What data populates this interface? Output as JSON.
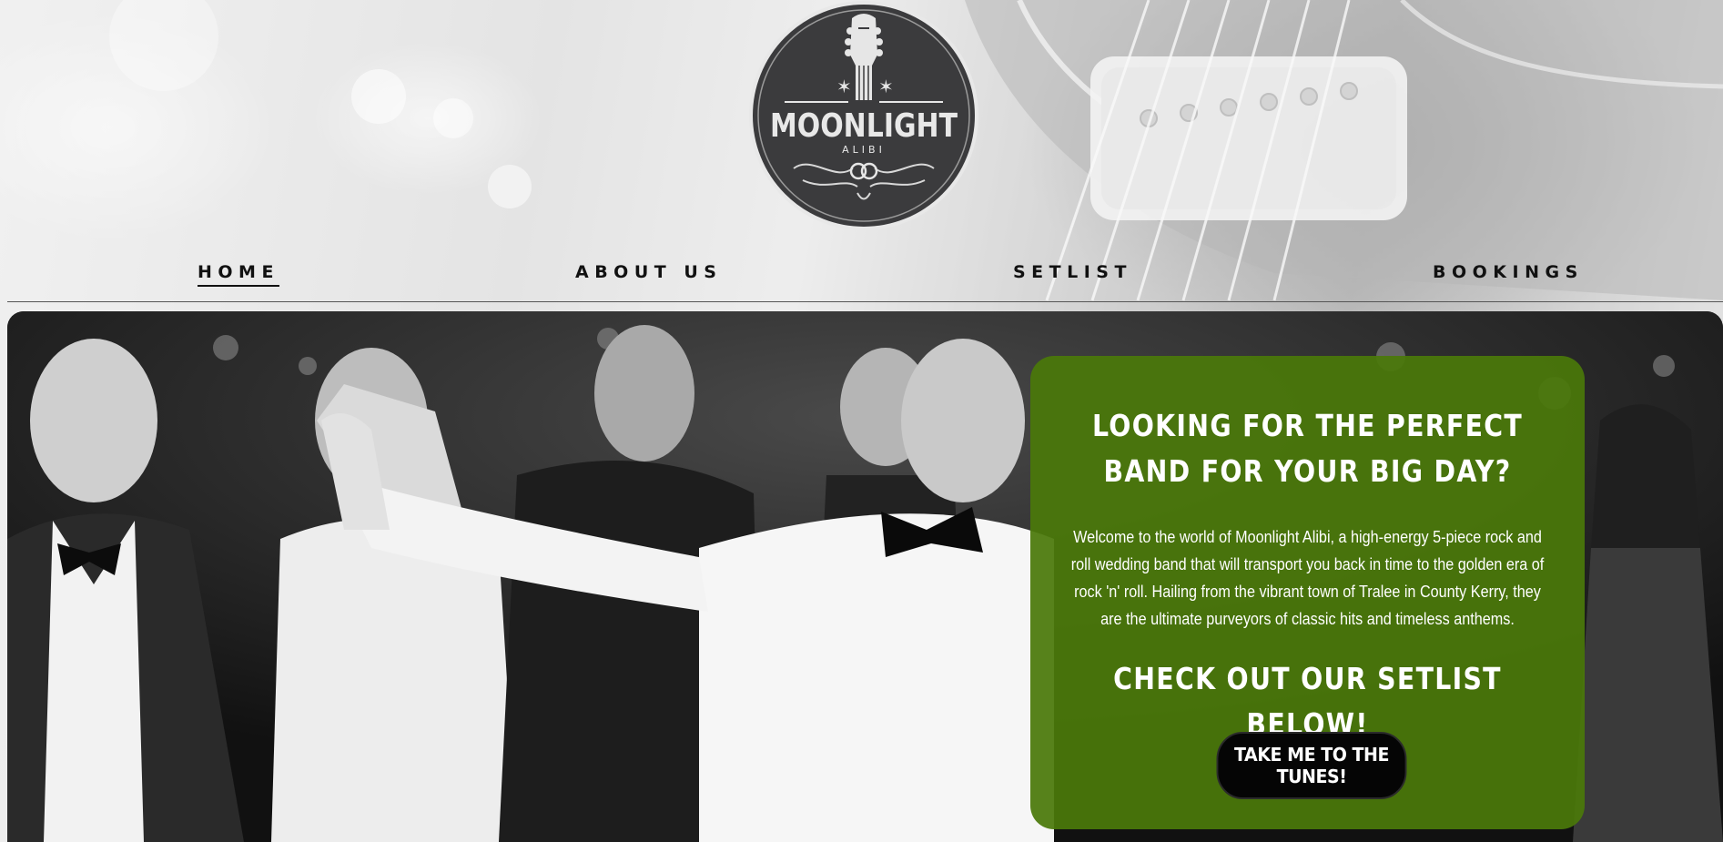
{
  "brand": {
    "name": "MOONLIGHT",
    "sub": "ALIBI"
  },
  "nav": {
    "items": [
      {
        "label": "HOME",
        "active": true
      },
      {
        "label": "ABOUT US",
        "active": false
      },
      {
        "label": "SETLIST",
        "active": false
      },
      {
        "label": "BOOKINGS",
        "active": false
      }
    ]
  },
  "hero": {
    "title": "LOOKING FOR THE PERFECT BAND FOR YOUR BIG DAY?",
    "body": "Welcome to the world of Moonlight Alibi, a high-energy 5-piece rock and roll wedding band that will transport you back in time to the golden era of rock 'n' roll. Hailing from the vibrant town of Tralee in County Kerry, they are the ultimate purveyors of classic hits and timeless anthems.",
    "subtitle": "CHECK OUT OUR SETLIST BELOW!",
    "cta_label": "TAKE ME TO THE TUNES!"
  },
  "colors": {
    "card_green": "#4a780a",
    "cta_black": "#050505",
    "nav_text": "#111111"
  }
}
